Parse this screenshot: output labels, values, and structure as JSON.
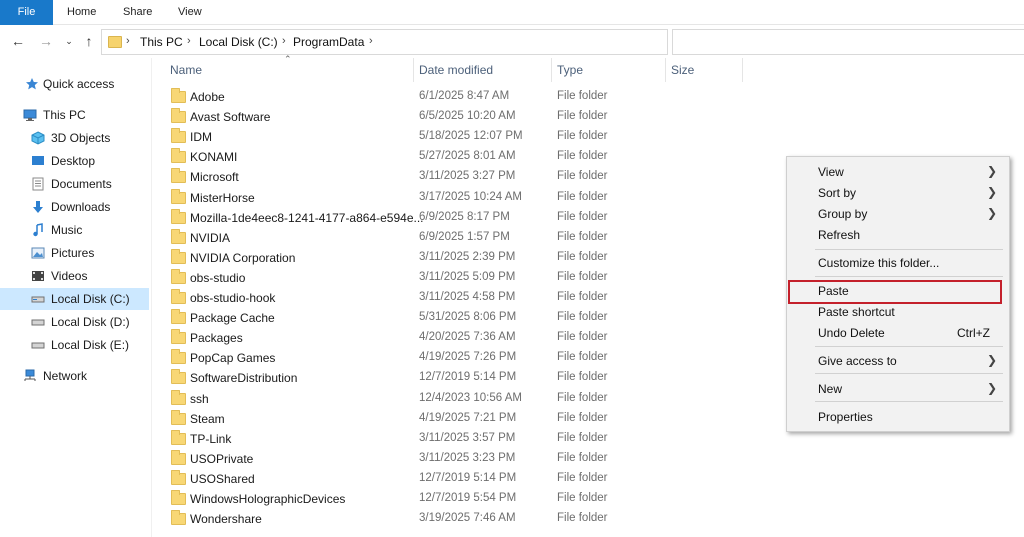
{
  "ribbon": {
    "tabs": [
      "File",
      "Home",
      "Share",
      "View"
    ]
  },
  "nav": {
    "back_icon": "arrow-left-icon",
    "forward_icon": "arrow-right-icon",
    "recent_icon": "chevron-down-icon",
    "up_icon": "arrow-up-icon"
  },
  "address": {
    "breadcrumbs": [
      "This PC",
      "Local Disk (C:)",
      "ProgramData"
    ]
  },
  "sidebar": {
    "items": [
      {
        "label": "Quick access",
        "icon": "star-icon"
      },
      {
        "label": "This PC",
        "icon": "computer-icon"
      },
      {
        "label": "3D Objects",
        "icon": "cube-icon"
      },
      {
        "label": "Desktop",
        "icon": "desktop-icon"
      },
      {
        "label": "Documents",
        "icon": "document-icon"
      },
      {
        "label": "Downloads",
        "icon": "download-icon"
      },
      {
        "label": "Music",
        "icon": "music-icon"
      },
      {
        "label": "Pictures",
        "icon": "picture-icon"
      },
      {
        "label": "Videos",
        "icon": "video-icon"
      },
      {
        "label": "Local Disk (C:)",
        "icon": "drive-icon",
        "selected": true
      },
      {
        "label": "Local Disk (D:)",
        "icon": "drive-icon"
      },
      {
        "label": "Local Disk (E:)",
        "icon": "drive-icon"
      },
      {
        "label": "Network",
        "icon": "network-icon"
      }
    ]
  },
  "columns": {
    "name": "Name",
    "date": "Date modified",
    "type": "Type",
    "size": "Size"
  },
  "files": [
    {
      "name": "Adobe",
      "date": "6/1/2025 8:47 AM",
      "type": "File folder"
    },
    {
      "name": "Avast Software",
      "date": "6/5/2025 10:20 AM",
      "type": "File folder"
    },
    {
      "name": "IDM",
      "date": "5/18/2025 12:07 PM",
      "type": "File folder"
    },
    {
      "name": "KONAMI",
      "date": "5/27/2025 8:01 AM",
      "type": "File folder"
    },
    {
      "name": "Microsoft",
      "date": "3/11/2025 3:27 PM",
      "type": "File folder"
    },
    {
      "name": "MisterHorse",
      "date": "3/17/2025 10:24 AM",
      "type": "File folder"
    },
    {
      "name": "Mozilla-1de4eec8-1241-4177-a864-e594e...",
      "date": "6/9/2025 8:17 PM",
      "type": "File folder"
    },
    {
      "name": "NVIDIA",
      "date": "6/9/2025 1:57 PM",
      "type": "File folder"
    },
    {
      "name": "NVIDIA Corporation",
      "date": "3/11/2025 2:39 PM",
      "type": "File folder"
    },
    {
      "name": "obs-studio",
      "date": "3/11/2025 5:09 PM",
      "type": "File folder"
    },
    {
      "name": "obs-studio-hook",
      "date": "3/11/2025 4:58 PM",
      "type": "File folder"
    },
    {
      "name": "Package Cache",
      "date": "5/31/2025 8:06 PM",
      "type": "File folder"
    },
    {
      "name": "Packages",
      "date": "4/20/2025 7:36 AM",
      "type": "File folder"
    },
    {
      "name": "PopCap Games",
      "date": "4/19/2025 7:26 PM",
      "type": "File folder"
    },
    {
      "name": "SoftwareDistribution",
      "date": "12/7/2019 5:14 PM",
      "type": "File folder"
    },
    {
      "name": "ssh",
      "date": "12/4/2023 10:56 AM",
      "type": "File folder"
    },
    {
      "name": "Steam",
      "date": "4/19/2025 7:21 PM",
      "type": "File folder"
    },
    {
      "name": "TP-Link",
      "date": "3/11/2025 3:57 PM",
      "type": "File folder"
    },
    {
      "name": "USOPrivate",
      "date": "3/11/2025 3:23 PM",
      "type": "File folder"
    },
    {
      "name": "USOShared",
      "date": "12/7/2019 5:14 PM",
      "type": "File folder"
    },
    {
      "name": "WindowsHolographicDevices",
      "date": "12/7/2019 5:54 PM",
      "type": "File folder"
    },
    {
      "name": "Wondershare",
      "date": "3/19/2025 7:46 AM",
      "type": "File folder"
    }
  ],
  "context_menu": {
    "items": [
      {
        "label": "View",
        "submenu": true
      },
      {
        "label": "Sort by",
        "submenu": true
      },
      {
        "label": "Group by",
        "submenu": true
      },
      {
        "label": "Refresh"
      },
      {
        "label": "Customize this folder..."
      },
      {
        "label": "Paste",
        "highlighted": true
      },
      {
        "label": "Paste shortcut"
      },
      {
        "label": "Undo Delete",
        "shortcut": "Ctrl+Z"
      },
      {
        "label": "Give access to",
        "submenu": true
      },
      {
        "label": "New",
        "submenu": true
      },
      {
        "label": "Properties"
      }
    ],
    "highlight_color": "#c4202b"
  },
  "colors": {
    "file_tab": "#1979ca",
    "selected_nav": "#cce8ff",
    "folder": "#f8d775"
  }
}
